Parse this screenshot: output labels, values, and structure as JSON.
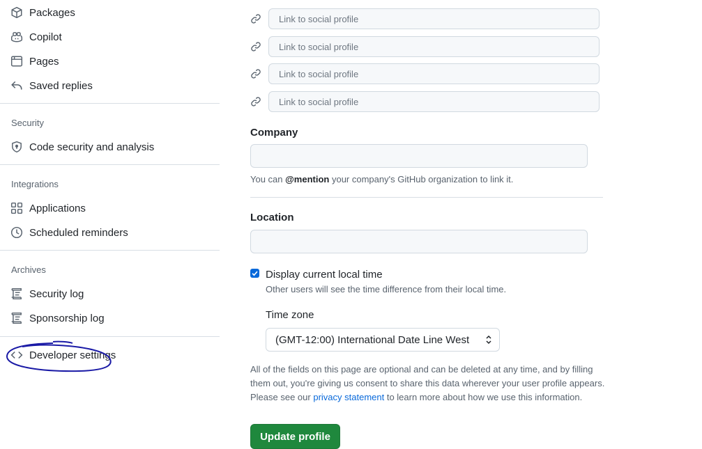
{
  "sidebar": {
    "items_top": [
      {
        "label": "Packages",
        "icon": "package-icon"
      },
      {
        "label": "Copilot",
        "icon": "copilot-icon"
      },
      {
        "label": "Pages",
        "icon": "browser-icon"
      },
      {
        "label": "Saved replies",
        "icon": "reply-icon"
      }
    ],
    "security": {
      "title": "Security",
      "items": [
        {
          "label": "Code security and analysis",
          "icon": "shield-icon"
        }
      ]
    },
    "integrations": {
      "title": "Integrations",
      "items": [
        {
          "label": "Applications",
          "icon": "apps-icon"
        },
        {
          "label": "Scheduled reminders",
          "icon": "clock-icon"
        }
      ]
    },
    "archives": {
      "title": "Archives",
      "items": [
        {
          "label": "Security log",
          "icon": "log-icon"
        },
        {
          "label": "Sponsorship log",
          "icon": "log-icon"
        }
      ]
    },
    "developer": {
      "label": "Developer settings",
      "icon": "code-icon"
    },
    "annotation_color": "#1a1aa6"
  },
  "main": {
    "social_links": [
      {
        "placeholder": "Link to social profile"
      },
      {
        "placeholder": "Link to social profile"
      },
      {
        "placeholder": "Link to social profile"
      },
      {
        "placeholder": "Link to social profile"
      }
    ],
    "company": {
      "label": "Company",
      "value": "",
      "hint_prefix": "You can ",
      "hint_mention": "@mention",
      "hint_suffix": " your company's GitHub organization to link it."
    },
    "location": {
      "label": "Location",
      "value": ""
    },
    "local_time": {
      "label": "Display current local time",
      "checked": true,
      "hint": "Other users will see the time difference from their local time."
    },
    "timezone": {
      "label": "Time zone",
      "selected": "(GMT-12:00) International Date Line West"
    },
    "disclaimer": {
      "before_link": "All of the fields on this page are optional and can be deleted at any time, and by filling them out, you're giving us consent to share this data wherever your user profile appears. Please see our ",
      "link": "privacy statement",
      "after_link": " to learn more about how we use this information."
    },
    "update_button": "Update profile"
  },
  "colors": {
    "accent": "#0969da",
    "primary_button": "#1f883d"
  }
}
